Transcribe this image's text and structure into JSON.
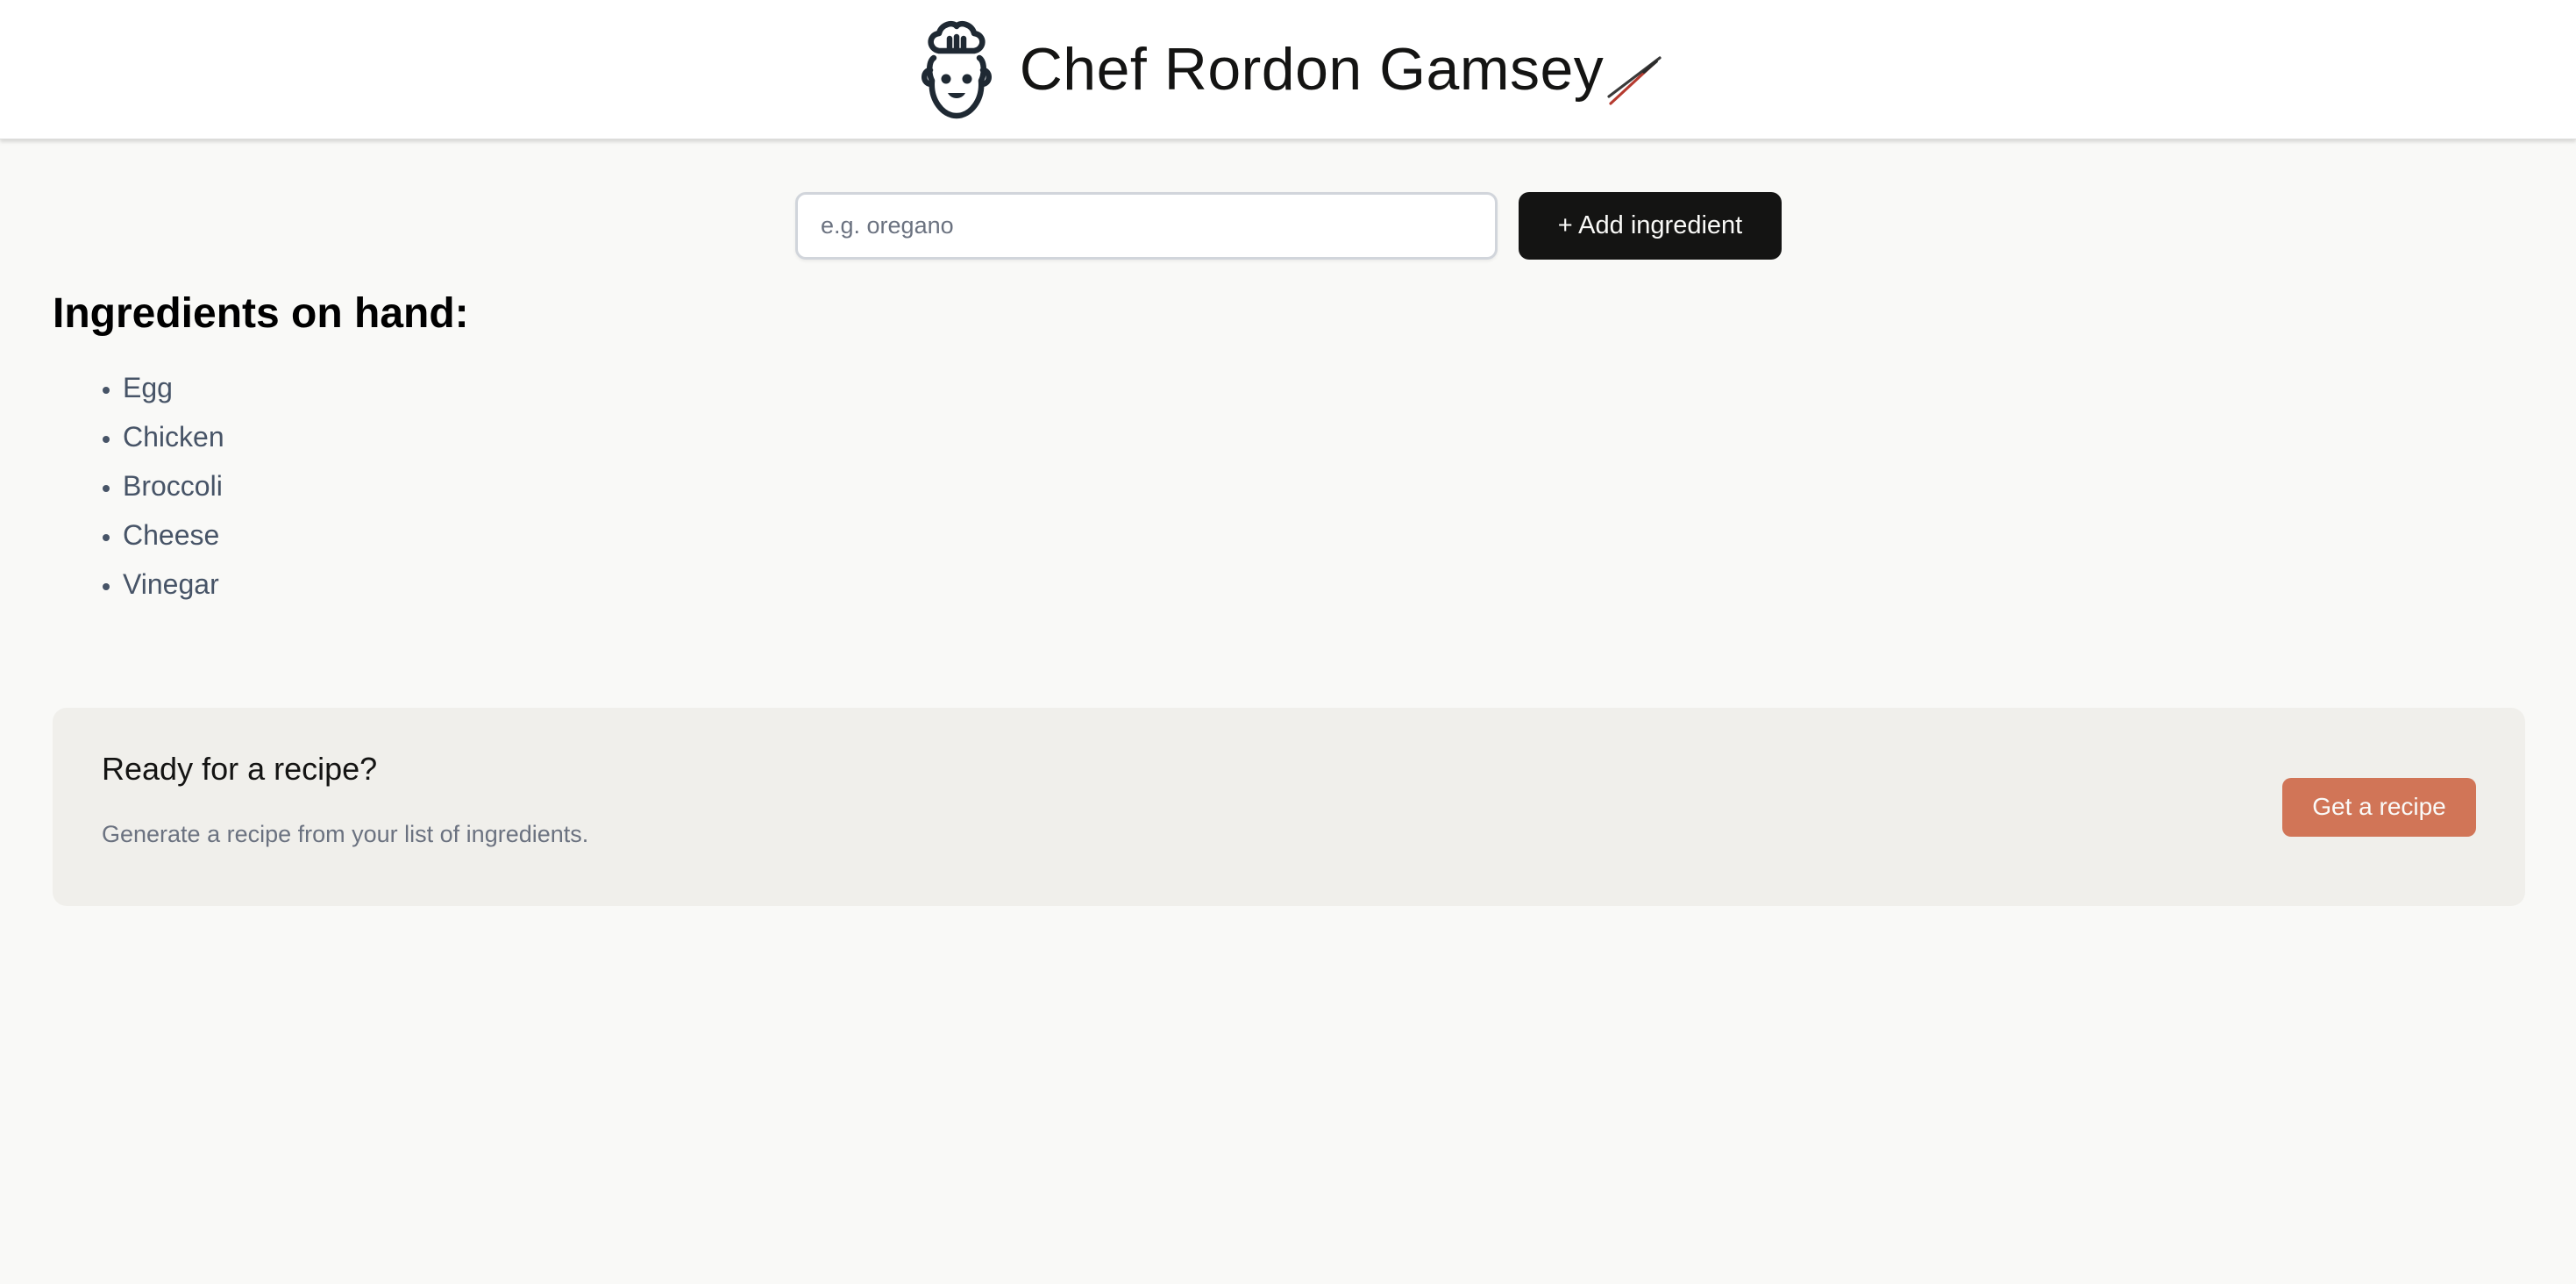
{
  "header": {
    "title": "Chef Rordon Gamsey",
    "logo_icon": "chef-face-icon",
    "title_icon": "chopsticks-icon"
  },
  "form": {
    "input_placeholder": "e.g. oregano",
    "input_value": "",
    "add_button_label": "+ Add ingredient"
  },
  "ingredients": {
    "heading": "Ingredients on hand:",
    "items": [
      "Egg",
      "Chicken",
      "Broccoli",
      "Cheese",
      "Vinegar"
    ]
  },
  "recipe_panel": {
    "title": "Ready for a recipe?",
    "description": "Generate a recipe from your list of ingredients.",
    "button_label": "Get a recipe"
  },
  "colors": {
    "background": "#f9f9f7",
    "header_background": "#ffffff",
    "primary_button": "#141413",
    "accent_button": "#d17557",
    "panel_background": "#f0efeb",
    "list_text": "#475467",
    "muted_text": "#6b7280"
  }
}
